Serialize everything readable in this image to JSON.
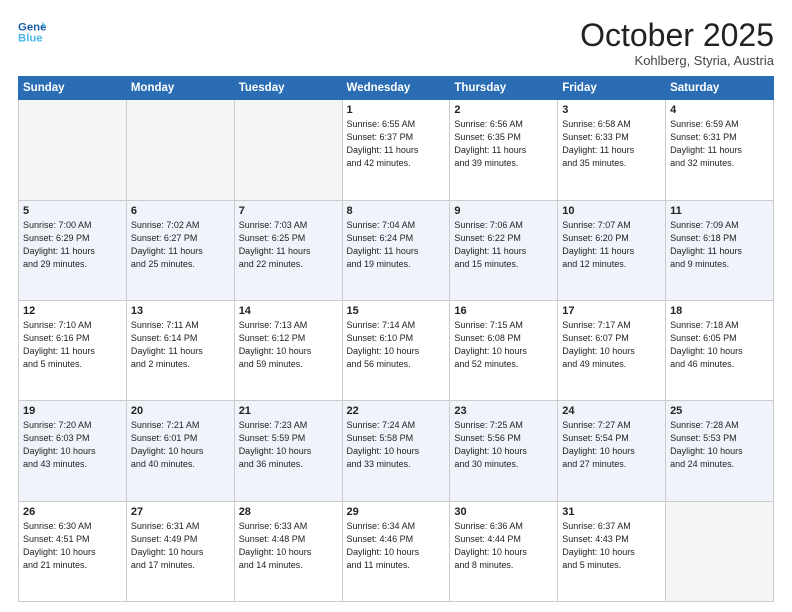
{
  "header": {
    "logo_line1": "General",
    "logo_line2": "Blue",
    "month": "October 2025",
    "location": "Kohlberg, Styria, Austria"
  },
  "days_of_week": [
    "Sunday",
    "Monday",
    "Tuesday",
    "Wednesday",
    "Thursday",
    "Friday",
    "Saturday"
  ],
  "weeks": [
    [
      {
        "num": "",
        "info": ""
      },
      {
        "num": "",
        "info": ""
      },
      {
        "num": "",
        "info": ""
      },
      {
        "num": "1",
        "info": "Sunrise: 6:55 AM\nSunset: 6:37 PM\nDaylight: 11 hours\nand 42 minutes."
      },
      {
        "num": "2",
        "info": "Sunrise: 6:56 AM\nSunset: 6:35 PM\nDaylight: 11 hours\nand 39 minutes."
      },
      {
        "num": "3",
        "info": "Sunrise: 6:58 AM\nSunset: 6:33 PM\nDaylight: 11 hours\nand 35 minutes."
      },
      {
        "num": "4",
        "info": "Sunrise: 6:59 AM\nSunset: 6:31 PM\nDaylight: 11 hours\nand 32 minutes."
      }
    ],
    [
      {
        "num": "5",
        "info": "Sunrise: 7:00 AM\nSunset: 6:29 PM\nDaylight: 11 hours\nand 29 minutes."
      },
      {
        "num": "6",
        "info": "Sunrise: 7:02 AM\nSunset: 6:27 PM\nDaylight: 11 hours\nand 25 minutes."
      },
      {
        "num": "7",
        "info": "Sunrise: 7:03 AM\nSunset: 6:25 PM\nDaylight: 11 hours\nand 22 minutes."
      },
      {
        "num": "8",
        "info": "Sunrise: 7:04 AM\nSunset: 6:24 PM\nDaylight: 11 hours\nand 19 minutes."
      },
      {
        "num": "9",
        "info": "Sunrise: 7:06 AM\nSunset: 6:22 PM\nDaylight: 11 hours\nand 15 minutes."
      },
      {
        "num": "10",
        "info": "Sunrise: 7:07 AM\nSunset: 6:20 PM\nDaylight: 11 hours\nand 12 minutes."
      },
      {
        "num": "11",
        "info": "Sunrise: 7:09 AM\nSunset: 6:18 PM\nDaylight: 11 hours\nand 9 minutes."
      }
    ],
    [
      {
        "num": "12",
        "info": "Sunrise: 7:10 AM\nSunset: 6:16 PM\nDaylight: 11 hours\nand 5 minutes."
      },
      {
        "num": "13",
        "info": "Sunrise: 7:11 AM\nSunset: 6:14 PM\nDaylight: 11 hours\nand 2 minutes."
      },
      {
        "num": "14",
        "info": "Sunrise: 7:13 AM\nSunset: 6:12 PM\nDaylight: 10 hours\nand 59 minutes."
      },
      {
        "num": "15",
        "info": "Sunrise: 7:14 AM\nSunset: 6:10 PM\nDaylight: 10 hours\nand 56 minutes."
      },
      {
        "num": "16",
        "info": "Sunrise: 7:15 AM\nSunset: 6:08 PM\nDaylight: 10 hours\nand 52 minutes."
      },
      {
        "num": "17",
        "info": "Sunrise: 7:17 AM\nSunset: 6:07 PM\nDaylight: 10 hours\nand 49 minutes."
      },
      {
        "num": "18",
        "info": "Sunrise: 7:18 AM\nSunset: 6:05 PM\nDaylight: 10 hours\nand 46 minutes."
      }
    ],
    [
      {
        "num": "19",
        "info": "Sunrise: 7:20 AM\nSunset: 6:03 PM\nDaylight: 10 hours\nand 43 minutes."
      },
      {
        "num": "20",
        "info": "Sunrise: 7:21 AM\nSunset: 6:01 PM\nDaylight: 10 hours\nand 40 minutes."
      },
      {
        "num": "21",
        "info": "Sunrise: 7:23 AM\nSunset: 5:59 PM\nDaylight: 10 hours\nand 36 minutes."
      },
      {
        "num": "22",
        "info": "Sunrise: 7:24 AM\nSunset: 5:58 PM\nDaylight: 10 hours\nand 33 minutes."
      },
      {
        "num": "23",
        "info": "Sunrise: 7:25 AM\nSunset: 5:56 PM\nDaylight: 10 hours\nand 30 minutes."
      },
      {
        "num": "24",
        "info": "Sunrise: 7:27 AM\nSunset: 5:54 PM\nDaylight: 10 hours\nand 27 minutes."
      },
      {
        "num": "25",
        "info": "Sunrise: 7:28 AM\nSunset: 5:53 PM\nDaylight: 10 hours\nand 24 minutes."
      }
    ],
    [
      {
        "num": "26",
        "info": "Sunrise: 6:30 AM\nSunset: 4:51 PM\nDaylight: 10 hours\nand 21 minutes."
      },
      {
        "num": "27",
        "info": "Sunrise: 6:31 AM\nSunset: 4:49 PM\nDaylight: 10 hours\nand 17 minutes."
      },
      {
        "num": "28",
        "info": "Sunrise: 6:33 AM\nSunset: 4:48 PM\nDaylight: 10 hours\nand 14 minutes."
      },
      {
        "num": "29",
        "info": "Sunrise: 6:34 AM\nSunset: 4:46 PM\nDaylight: 10 hours\nand 11 minutes."
      },
      {
        "num": "30",
        "info": "Sunrise: 6:36 AM\nSunset: 4:44 PM\nDaylight: 10 hours\nand 8 minutes."
      },
      {
        "num": "31",
        "info": "Sunrise: 6:37 AM\nSunset: 4:43 PM\nDaylight: 10 hours\nand 5 minutes."
      },
      {
        "num": "",
        "info": ""
      }
    ]
  ]
}
